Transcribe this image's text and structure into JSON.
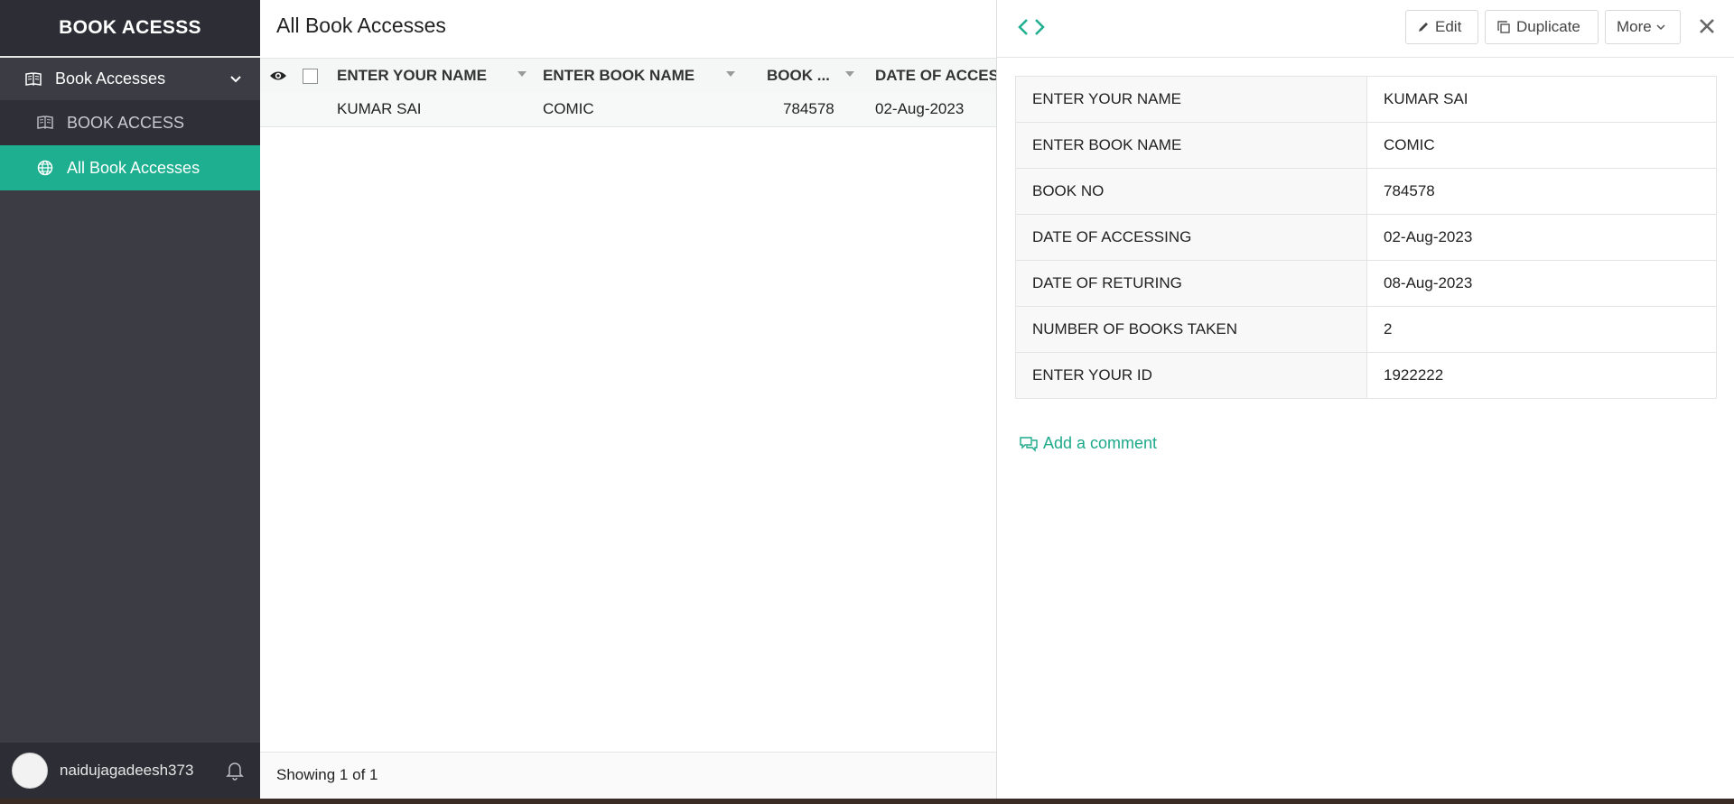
{
  "app": {
    "title": "BOOK ACESSS"
  },
  "sidebar": {
    "parent": {
      "label": "Book Accesses"
    },
    "items": [
      {
        "label": "BOOK ACCESS"
      },
      {
        "label": "All Book Accesses"
      }
    ],
    "user": {
      "name": "naidujagadeesh373"
    }
  },
  "list": {
    "title": "All Book Accesses",
    "columns": [
      "ENTER YOUR NAME",
      "ENTER BOOK NAME",
      "BOOK ...",
      "DATE OF ACCES"
    ],
    "rows": [
      {
        "name": "KUMAR SAI",
        "book": "COMIC",
        "book_no": "784578",
        "date": "02-Aug-2023"
      }
    ],
    "showing": "Showing 1 of 1"
  },
  "detail": {
    "buttons": {
      "edit": "Edit",
      "duplicate": "Duplicate",
      "more": "More"
    },
    "fields": [
      {
        "label": "ENTER YOUR NAME",
        "value": "KUMAR SAI"
      },
      {
        "label": "ENTER BOOK NAME",
        "value": "COMIC"
      },
      {
        "label": "BOOK NO",
        "value": "784578"
      },
      {
        "label": "DATE OF ACCESSING",
        "value": "02-Aug-2023"
      },
      {
        "label": "DATE OF RETURING",
        "value": "08-Aug-2023"
      },
      {
        "label": "NUMBER OF BOOKS TAKEN",
        "value": "2"
      },
      {
        "label": "ENTER YOUR ID",
        "value": "1922222"
      }
    ],
    "add_comment": "Add a comment"
  },
  "colors": {
    "accent": "#1daf8f",
    "sidebar": "#3b3c44",
    "sidebar_dark": "#2d2e35"
  }
}
